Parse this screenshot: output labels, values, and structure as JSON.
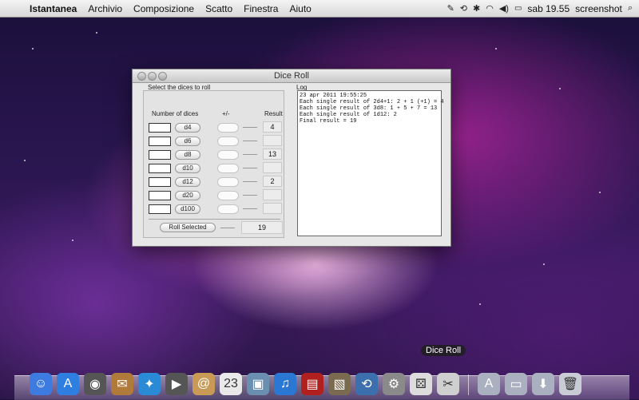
{
  "menubar": {
    "apple": "",
    "app_name": "Istantanea",
    "menus": [
      "Archivio",
      "Composizione",
      "Scatto",
      "Finestra",
      "Aiuto"
    ],
    "status": {
      "clock": "sab 19.55",
      "user": "screenshot"
    }
  },
  "window": {
    "title": "Dice Roll",
    "left_group_label": "Select the dices to roll",
    "headers": {
      "count": "Number of dices",
      "modifier": "+/-",
      "result": "Result"
    },
    "rows": [
      {
        "die": "d4",
        "result": "4"
      },
      {
        "die": "d6",
        "result": ""
      },
      {
        "die": "d8",
        "result": "13"
      },
      {
        "die": "d10",
        "result": ""
      },
      {
        "die": "d12",
        "result": "2"
      },
      {
        "die": "d20",
        "result": ""
      },
      {
        "die": "d100",
        "result": ""
      }
    ],
    "roll_button": "Roll Selected",
    "final_result": "19",
    "log_label": "Log",
    "log_lines": [
      "23 apr 2011 19:55:25",
      "Each single result of 2d4+1: 2 + 1 (+1) = 4",
      "Each single result of 3d8: 1 + 5 + 7 = 13",
      "Each single result of 1d12: 2",
      "Final result = 19"
    ]
  },
  "dock": {
    "tooltip": "Dice Roll",
    "icons": [
      {
        "name": "finder-icon",
        "color": "#3d7be0",
        "glyph": "☺"
      },
      {
        "name": "app-store-icon",
        "color": "#2f7fe0",
        "glyph": "A"
      },
      {
        "name": "dashboard-icon",
        "color": "#555555",
        "glyph": "◉"
      },
      {
        "name": "mail-icon",
        "color": "#b07a3a",
        "glyph": "✉"
      },
      {
        "name": "safari-icon",
        "color": "#2b8ad6",
        "glyph": "✦"
      },
      {
        "name": "facetime-icon",
        "color": "#555555",
        "glyph": "▶"
      },
      {
        "name": "address-book-icon",
        "color": "#c89a55",
        "glyph": "@"
      },
      {
        "name": "ical-icon",
        "color": "#e9e9e9",
        "glyph": "23"
      },
      {
        "name": "preview-icon",
        "color": "#6a8fb0",
        "glyph": "▣"
      },
      {
        "name": "itunes-icon",
        "color": "#2a78d4",
        "glyph": "♫"
      },
      {
        "name": "photo-booth-icon",
        "color": "#b0201e",
        "glyph": "▤"
      },
      {
        "name": "iphoto-icon",
        "color": "#7a6a50",
        "glyph": "▧"
      },
      {
        "name": "time-machine-icon",
        "color": "#3b6fae",
        "glyph": "⟲"
      },
      {
        "name": "system-preferences-icon",
        "color": "#8a8a8a",
        "glyph": "⚙"
      },
      {
        "name": "dice-roll-icon",
        "color": "#dcdcdc",
        "glyph": "⚄"
      },
      {
        "name": "script-editor-icon",
        "color": "#cfcfcf",
        "glyph": "✂"
      },
      {
        "name": "applications-stack-icon",
        "color": "#aab0c0",
        "glyph": "A"
      },
      {
        "name": "documents-stack-icon",
        "color": "#aab0c0",
        "glyph": "▭"
      },
      {
        "name": "downloads-stack-icon",
        "color": "#aab0c0",
        "glyph": "⬇"
      },
      {
        "name": "trash-icon",
        "color": "#c9ccd4",
        "glyph": "🗑"
      }
    ]
  }
}
